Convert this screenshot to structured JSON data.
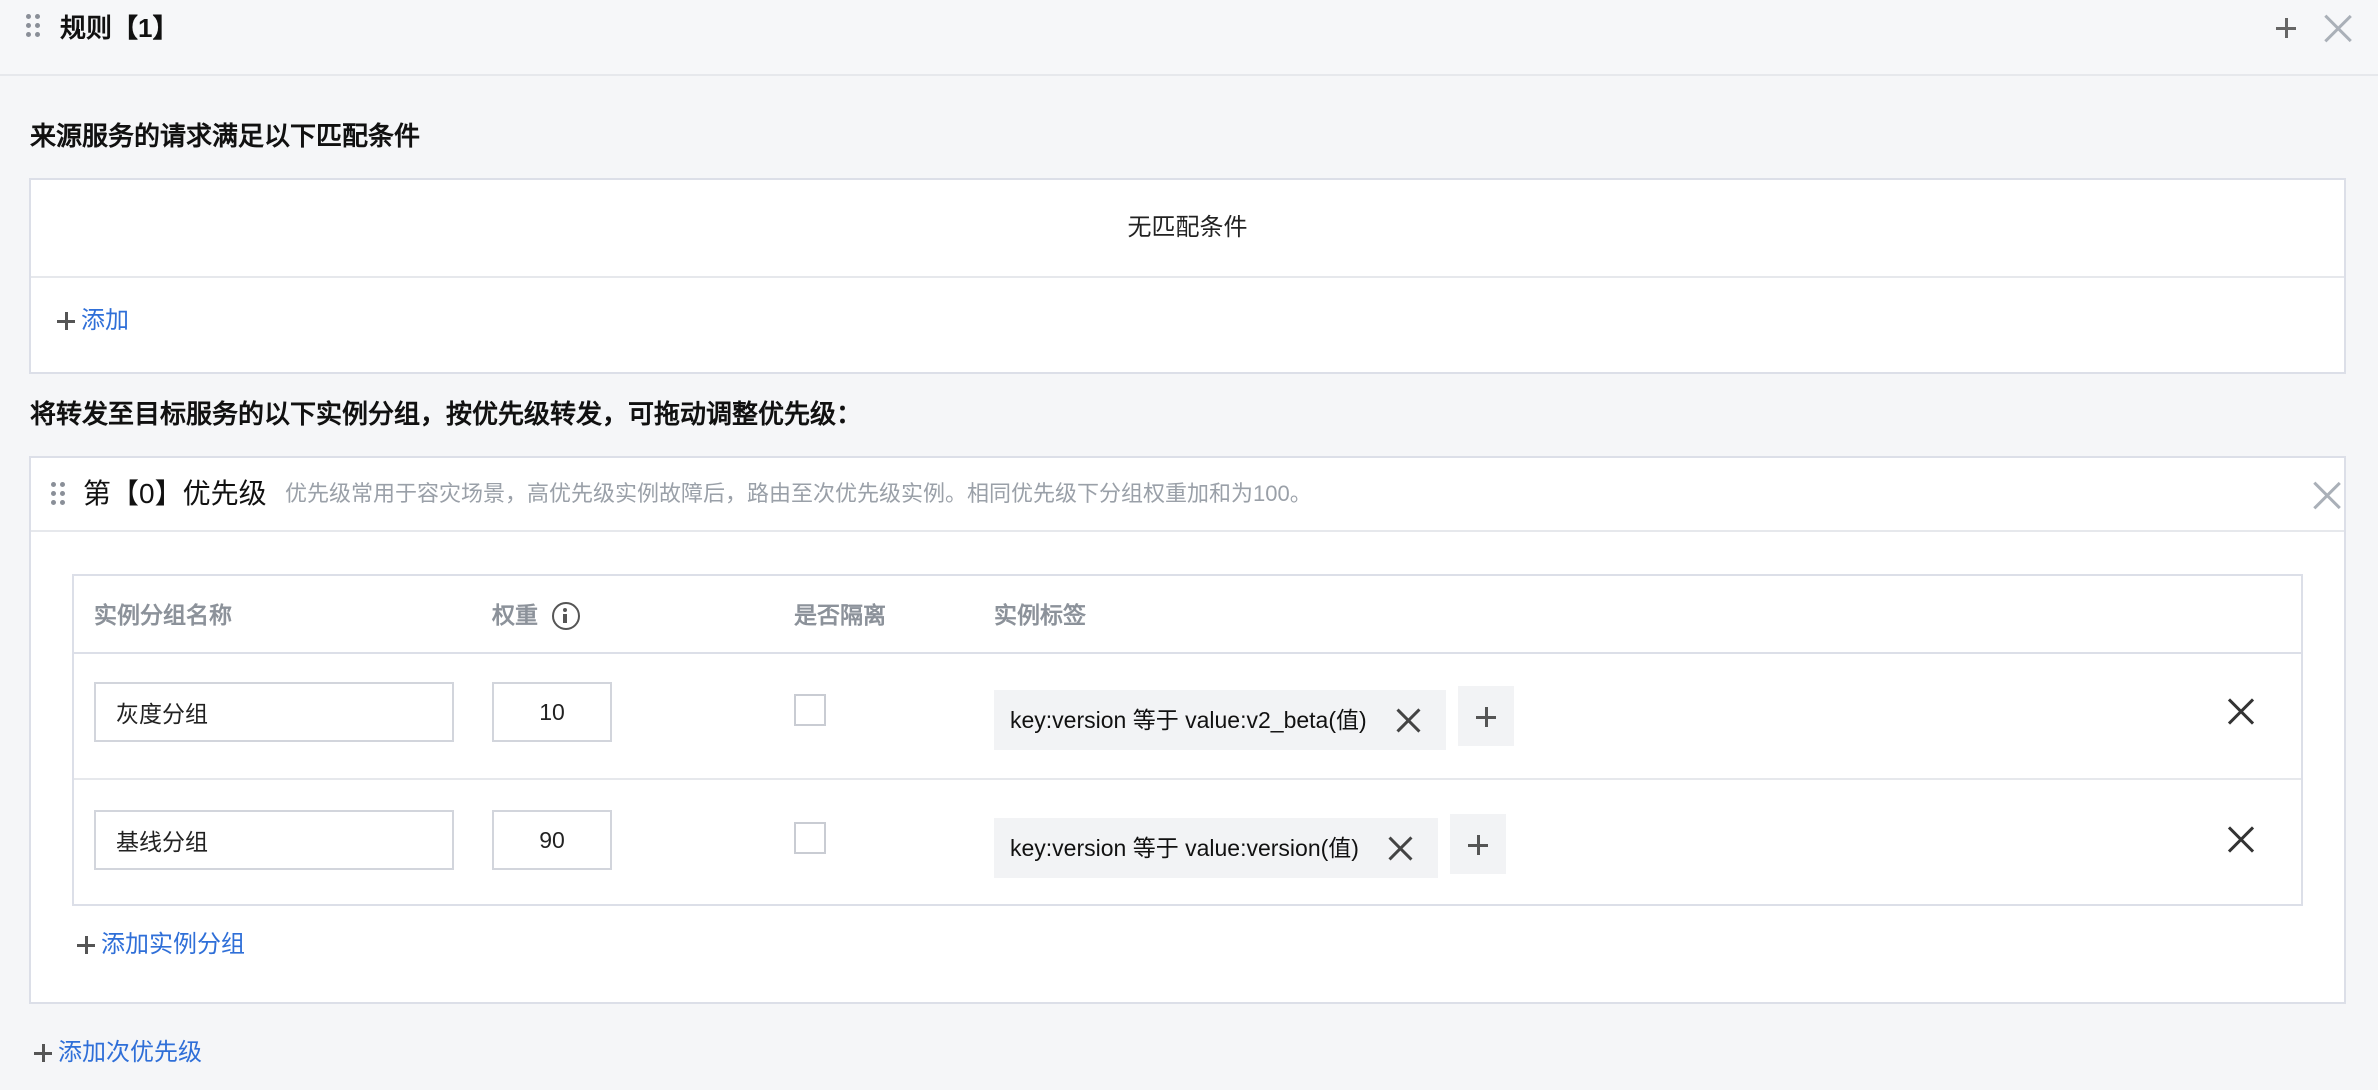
{
  "rule": {
    "title": "规则【1】",
    "actions": [
      "plus-icon",
      "close-icon"
    ]
  },
  "match_section": {
    "title": "来源服务的请求满足以下匹配条件",
    "empty_text": "无匹配条件",
    "add_label": "添加"
  },
  "forward_section": {
    "title": "将转发至目标服务的以下实例分组，按优先级转发，可拖动调整优先级："
  },
  "priority": {
    "title": "第【0】优先级",
    "description": "优先级常用于容灾场景，高优先级实例故障后，路由至次优先级实例。相同优先级下分组权重加和为100。",
    "columns": [
      "实例分组名称",
      "权重",
      "是否隔离",
      "实例标签"
    ],
    "rows": [
      {
        "name": "灰度分组",
        "weight": "10",
        "isolated": false,
        "tag": "key:version 等于 value:v2_beta(值)"
      },
      {
        "name": "基线分组",
        "weight": "90",
        "isolated": false,
        "tag": "key:version 等于 value:version(值)"
      }
    ],
    "add_group_label": "添加实例分组"
  },
  "add_priority_label": "添加次优先级",
  "colors": {
    "link": "#2f6fd8",
    "border": "#dcdfe8",
    "background": "#f5f6f8"
  }
}
